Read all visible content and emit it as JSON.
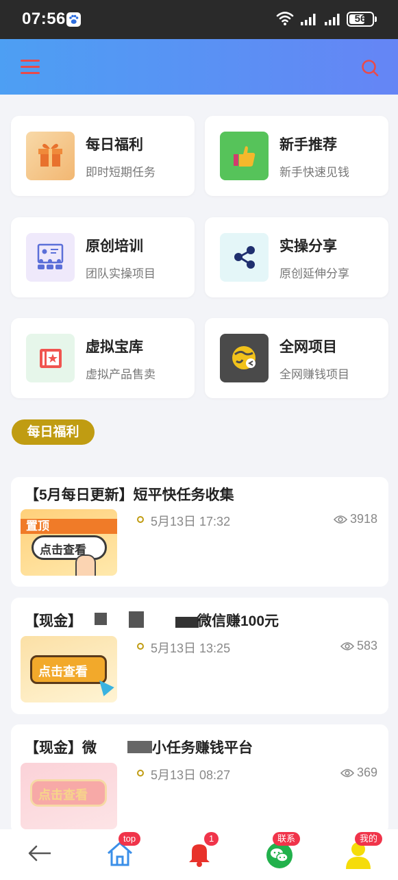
{
  "status_bar": {
    "time": "07:56",
    "battery": "56"
  },
  "grid": [
    {
      "title": "每日福利",
      "subtitle": "即时短期任务"
    },
    {
      "title": "新手推荐",
      "subtitle": "新手快速见钱"
    },
    {
      "title": "原创培训",
      "subtitle": "团队实操项目"
    },
    {
      "title": "实操分享",
      "subtitle": "原创延伸分享"
    },
    {
      "title": "虚拟宝库",
      "subtitle": "虚拟产品售卖"
    },
    {
      "title": "全网项目",
      "subtitle": "全网赚钱项目"
    }
  ],
  "section": {
    "label": "每日福利"
  },
  "articles": [
    {
      "title": "【5月每日更新】短平快任务收集",
      "date": "5月13日 17:32",
      "views": "3918",
      "thumb_badge": "置顶",
      "thumb_text": "点击查看"
    },
    {
      "title_start": "【现金】",
      "title_end": "微信赚100元",
      "date": "5月13日 13:25",
      "views": "583",
      "thumb_text": "点击查看"
    },
    {
      "title_start": "【现金】微",
      "title_end": "小任务赚钱平台",
      "date": "5月13日 08:27",
      "views": "369",
      "thumb_text": "点击查看"
    }
  ],
  "bottom_nav": {
    "home_badge": "top",
    "notify_badge": "1",
    "chat_badge": "联系",
    "me_badge": "我的"
  },
  "colors": {
    "accent": "#c09c12",
    "header_start": "#4d9ff3",
    "header_end": "#6585f5",
    "badge": "#f0344a"
  }
}
